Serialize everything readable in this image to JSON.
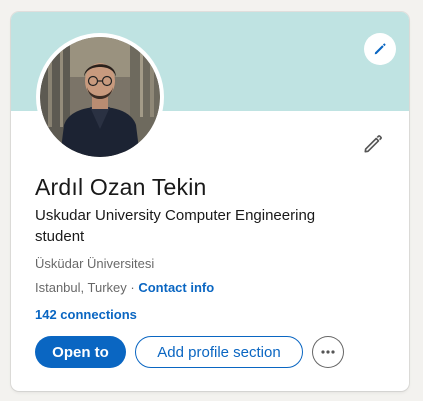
{
  "profile": {
    "name": "Ardıl Ozan Tekin",
    "headline": "Uskudar University Computer Engineering student",
    "school": "Üsküdar Üniversitesi",
    "location": "Istanbul, Turkey",
    "separator": " · ",
    "contact_info_label": "Contact info",
    "connections_label": "142 connections"
  },
  "actions": {
    "open_to_label": "Open to",
    "add_section_label": "Add profile section",
    "more_icon": "more-horizontal-icon"
  },
  "icons": {
    "cover_edit": "pencil-icon",
    "intro_edit": "pencil-icon"
  },
  "colors": {
    "cover": "#bfe3e2",
    "accent": "#0a66c2",
    "page_bg": "#f3f2ef"
  }
}
